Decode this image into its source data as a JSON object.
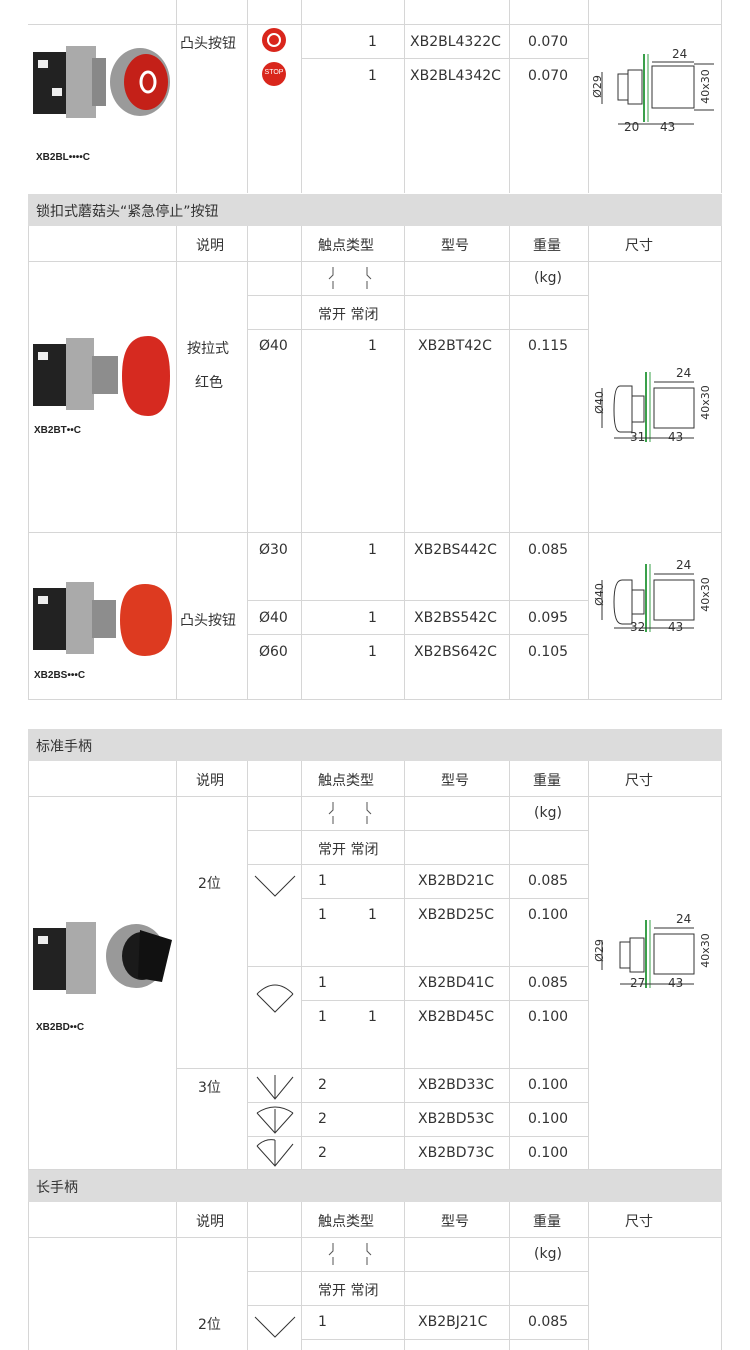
{
  "headers": {
    "desc": "说明",
    "contact": "触点类型",
    "model": "型号",
    "weight": "重量",
    "dim": "尺寸",
    "unit": "(kg)",
    "no_nc": "常开 常闭"
  },
  "sec0": {
    "caption": "XB2BL••••C",
    "desc": "凸头按钮",
    "rows": [
      {
        "qty": "1",
        "model": "XB2BL4322C",
        "weight": "0.070"
      },
      {
        "qty": "1",
        "model": "XB2BL4342C",
        "weight": "0.070"
      }
    ],
    "stop_text": "STOP",
    "dim": {
      "d": "Ø29",
      "a": "20",
      "b": "43",
      "c": "24",
      "h": "40x30"
    }
  },
  "sec1": {
    "title": "锁扣式蘑菇头“紧急停止”按钮",
    "prodA": {
      "caption": "XB2BT••C",
      "desc1": "按拉式",
      "desc2": "红色",
      "size": "Ø40",
      "qty": "1",
      "model": "XB2BT42C",
      "weight": "0.115",
      "dim": {
        "d": "Ø40",
        "a": "31",
        "b": "43",
        "c": "24",
        "h": "40x30"
      }
    },
    "prodB": {
      "caption": "XB2BS•••C",
      "desc": "凸头按钮",
      "rows": [
        {
          "size": "Ø30",
          "qty": "1",
          "model": "XB2BS442C",
          "weight": "0.085"
        },
        {
          "size": "Ø40",
          "qty": "1",
          "model": "XB2BS542C",
          "weight": "0.095"
        },
        {
          "size": "Ø60",
          "qty": "1",
          "model": "XB2BS642C",
          "weight": "0.105"
        }
      ],
      "dim": {
        "d": "Ø40",
        "a": "32",
        "b": "43",
        "c": "24",
        "h": "40x30"
      }
    }
  },
  "sec2": {
    "title": "标准手柄",
    "caption": "XB2BD••C",
    "pos2": "2位",
    "pos3": "3位",
    "rows": [
      {
        "no": "1",
        "nc": "",
        "model": "XB2BD21C",
        "weight": "0.085"
      },
      {
        "no": "1",
        "nc": "1",
        "model": "XB2BD25C",
        "weight": "0.100"
      },
      {
        "no": "1",
        "nc": "",
        "model": "XB2BD41C",
        "weight": "0.085"
      },
      {
        "no": "1",
        "nc": "1",
        "model": "XB2BD45C",
        "weight": "0.100"
      },
      {
        "no": "2",
        "nc": "",
        "model": "XB2BD33C",
        "weight": "0.100"
      },
      {
        "no": "2",
        "nc": "",
        "model": "XB2BD53C",
        "weight": "0.100"
      },
      {
        "no": "2",
        "nc": "",
        "model": "XB2BD73C",
        "weight": "0.100"
      }
    ],
    "dim": {
      "d": "Ø29",
      "a": "27",
      "b": "43",
      "c": "24",
      "h": "40x30"
    }
  },
  "sec3": {
    "title": "长手柄",
    "pos2": "2位",
    "rows": [
      {
        "no": "1",
        "model": "XB2BJ21C",
        "weight": "0.085"
      }
    ]
  },
  "colors": {
    "band": "#dcdcdc",
    "grid": "#d6d6d6",
    "red": "#d9261c",
    "green": "#3aa04a"
  }
}
